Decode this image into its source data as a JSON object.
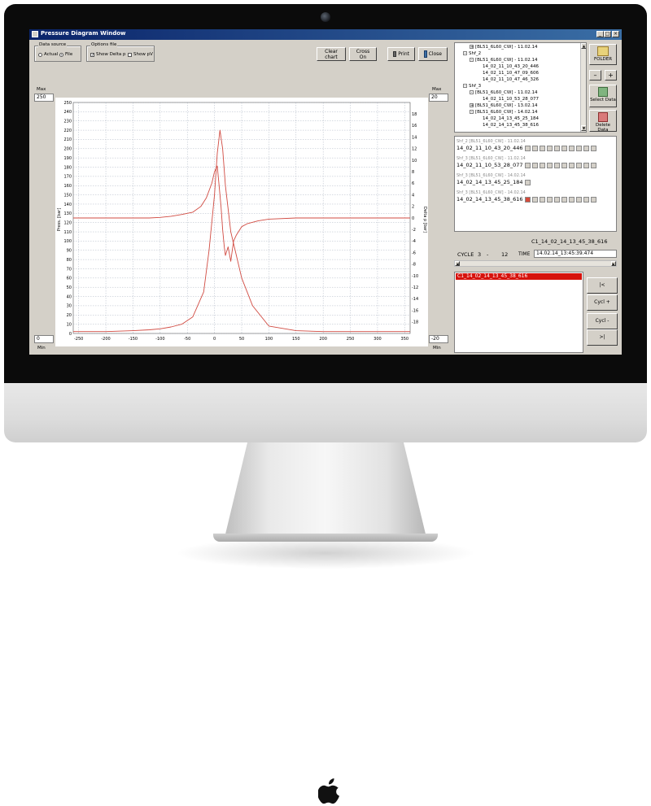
{
  "window": {
    "title": "Pressure Diagram Window"
  },
  "toolbar": {
    "data_source_title": "Data source",
    "actual_label": "Actual",
    "file_label": "File",
    "options_title": "Options file",
    "show_delta_label": "Show Delta p",
    "show_pv_label": "Show pV",
    "clear_chart_label": "Clear chart",
    "cross_on_label": "Cross On",
    "print_label": "Print",
    "close_label": "Close"
  },
  "plot_controls": {
    "max_label_left": "Max",
    "max_value_left": "250",
    "min_value_left": "0",
    "min_label_left": "Min",
    "max_label_right": "Max",
    "max_value_right": "20",
    "min_value_right": "-20",
    "min_label_right": "Min"
  },
  "chart_data": {
    "type": "line",
    "xlim": [
      -260,
      360
    ],
    "ylim_left": [
      0,
      250
    ],
    "ylim_right": [
      -20,
      20
    ],
    "ylabel_left": "Press. [bar]",
    "ylabel_right": "Delta p [bar]",
    "grid": true,
    "x_ticks": [
      "-250",
      "-200",
      "-150",
      "-100",
      "-50",
      "0",
      "50",
      "100",
      "150",
      "200",
      "250",
      "300",
      "350"
    ],
    "y_ticks_left": [
      "0",
      "10",
      "20",
      "30",
      "40",
      "50",
      "60",
      "70",
      "80",
      "90",
      "100",
      "110",
      "120",
      "130",
      "140",
      "150",
      "160",
      "170",
      "180",
      "190",
      "200",
      "210",
      "220",
      "230",
      "240",
      "250"
    ],
    "y_ticks_right": [
      "-18",
      "-16",
      "-14",
      "-12",
      "-10",
      "-8",
      "-6",
      "-4",
      "-2",
      "0",
      "2",
      "4",
      "6",
      "8",
      "10",
      "12",
      "14",
      "16",
      "18"
    ],
    "color": "#d14b42",
    "series": [
      {
        "axis": "left",
        "x": [
          -260,
          -200,
          -150,
          -120,
          -100,
          -80,
          -60,
          -40,
          -20,
          -10,
          0,
          5,
          10,
          15,
          20,
          30,
          40,
          50,
          70,
          100,
          150,
          200,
          250,
          300,
          360
        ],
        "values": [
          2,
          2,
          3,
          4,
          5,
          7,
          10,
          18,
          45,
          90,
          150,
          195,
          220,
          200,
          160,
          110,
          85,
          60,
          30,
          8,
          3,
          2,
          2,
          2,
          2
        ]
      },
      {
        "axis": "right",
        "x": [
          -260,
          -200,
          -150,
          -120,
          -100,
          -80,
          -60,
          -40,
          -25,
          -15,
          -5,
          0,
          5,
          8,
          12,
          15,
          18,
          20,
          25,
          30,
          35,
          40,
          50,
          60,
          80,
          100,
          150,
          200,
          250,
          300,
          360
        ],
        "values": [
          0,
          0,
          0,
          0,
          0.1,
          0.3,
          0.6,
          1,
          2,
          3.5,
          6,
          8,
          9,
          6,
          2,
          -2,
          -5,
          -6.5,
          -5,
          -7.5,
          -4,
          -3,
          -1.5,
          -1,
          -0.5,
          -0.2,
          0,
          0,
          0,
          0,
          0
        ]
      }
    ]
  },
  "tree": {
    "items": [
      {
        "text": "[BL51_6L60_CW] - 11.02.14",
        "level": 2,
        "exp": "+"
      },
      {
        "text": "Shf_2",
        "level": 1,
        "exp": "-"
      },
      {
        "text": "[BL51_6L60_CW] - 11.02.14",
        "level": 2,
        "exp": "-"
      },
      {
        "text": "14_02_11_10_43_20_446",
        "level": 3,
        "exp": ""
      },
      {
        "text": "14_02_11_10_47_09_606",
        "level": 3,
        "exp": ""
      },
      {
        "text": "14_02_11_10_47_46_326",
        "level": 3,
        "exp": ""
      },
      {
        "text": "Shf_3",
        "level": 1,
        "exp": "-"
      },
      {
        "text": "[BL51_6L60_CW] - 11.02.14",
        "level": 2,
        "exp": "-"
      },
      {
        "text": "14_02_11_10_53_28_077",
        "level": 3,
        "exp": ""
      },
      {
        "text": "[BL51_6L60_CW] - 13.02.14",
        "level": 2,
        "exp": "+"
      },
      {
        "text": "[BL51_6L60_CW] - 14.02.14",
        "level": 2,
        "exp": "-"
      },
      {
        "text": "14_02_14_13_45_25_184",
        "level": 3,
        "exp": ""
      },
      {
        "text": "14_02_14_13_45_38_616",
        "level": 3,
        "exp": ""
      }
    ]
  },
  "side_buttons": {
    "folder": "FOLDER",
    "minus": "–",
    "plus": "+",
    "select": "Select Data",
    "delete": "Delete Data"
  },
  "datasets": [
    {
      "label": "Shf_2  [BL51_6L60_CW] - 11.02.14",
      "name": "14_02_11_10_43_20_446",
      "boxes": 10,
      "active": -1
    },
    {
      "label": "Shf_3  [BL51_6L60_CW] - 11.02.14",
      "name": "14_02_11_10_53_28_077",
      "boxes": 10,
      "active": -1
    },
    {
      "label": "Shf_3  [BL51_6L60_CW] - 14.02.14",
      "name": "14_02_14_13_45_25_184",
      "boxes": 1,
      "active": -1
    },
    {
      "label": "Shf_3  [BL51_6L60_CW] - 14.02.14",
      "name": "14_02_14_13_45_38_616",
      "boxes": 10,
      "active": 0
    }
  ],
  "cycle": {
    "file_title": "C1_14_02_14_13_45_38_616",
    "cycle_label": "CYCLE",
    "cycle_value": "3",
    "sep": "-",
    "cycle_total": "12",
    "time_label": "TIME",
    "time_value": "14.02.14_13:45:39.474"
  },
  "cycle_list": {
    "selected": "C1_14_02_14_13_45_38_616"
  },
  "nav_buttons": {
    "first": "|<",
    "next": "Cycl +",
    "prev": "Cycl -",
    "last": ">|"
  }
}
